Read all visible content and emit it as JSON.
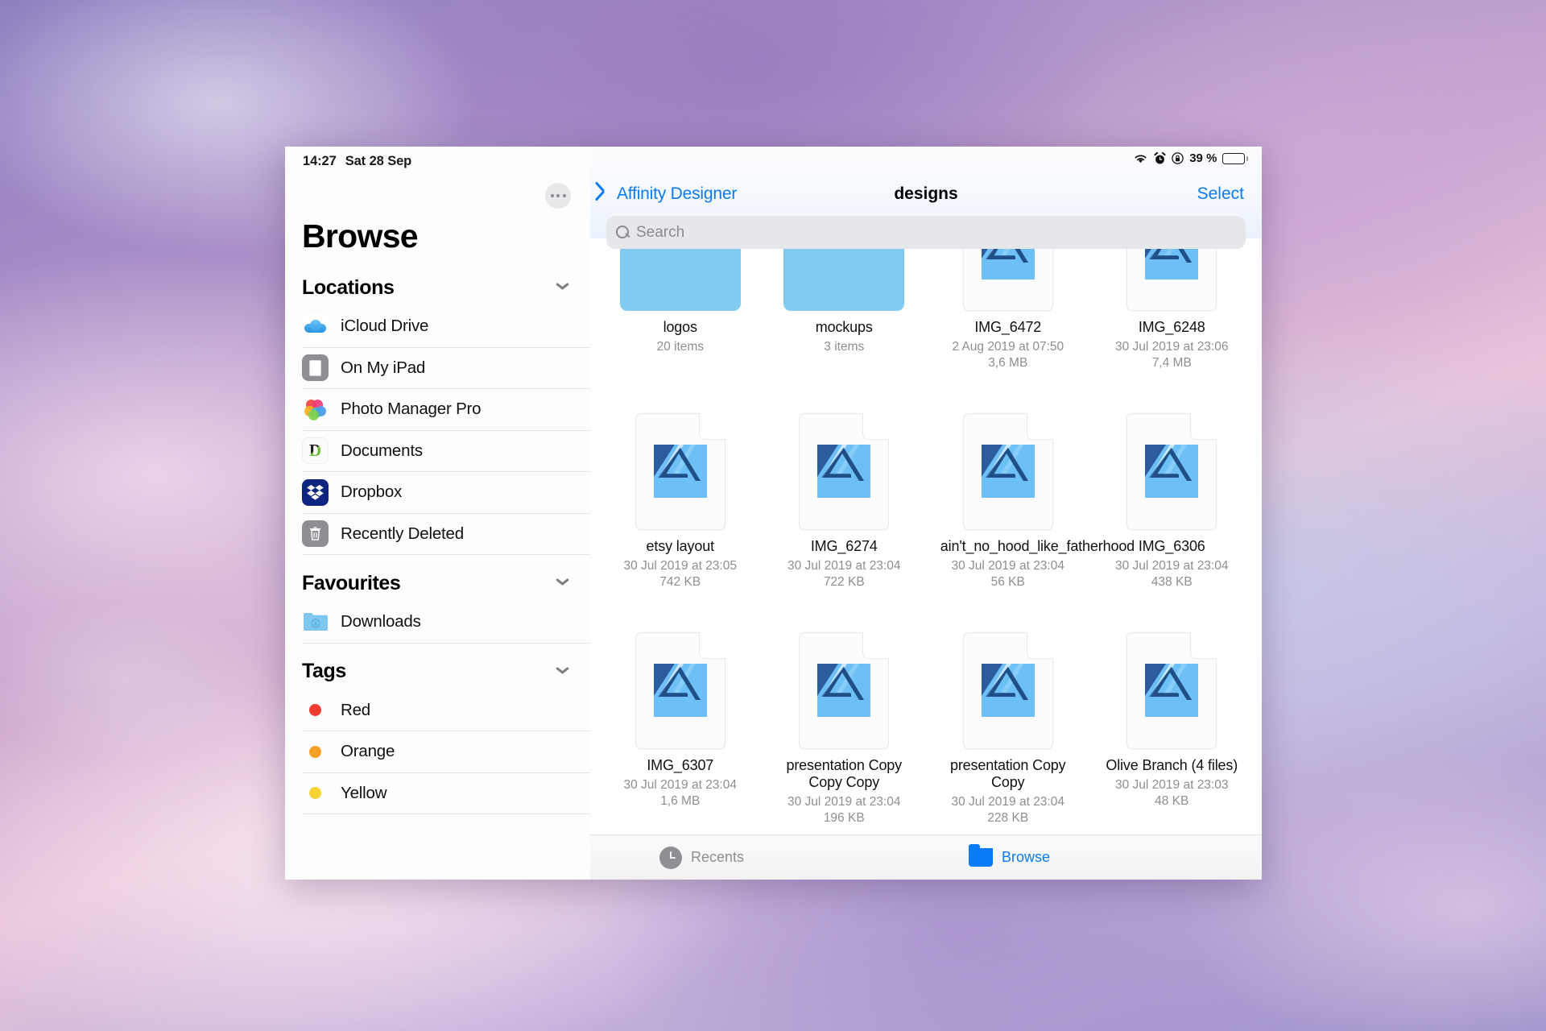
{
  "wallpaper": {
    "description": "pastel purple pink cloud sky"
  },
  "statusbar": {
    "time": "14:27",
    "date": "Sat 28 Sep",
    "wifi_icon": "wifi-icon",
    "alarm_icon": "alarm-clock-icon",
    "rotation_lock_icon": "rotation-lock-icon",
    "battery_percent": "39 %",
    "battery_icon": "battery-icon",
    "battery_level": 39
  },
  "sidebar": {
    "more_button": "more-options-icon",
    "title": "Browse",
    "sections": [
      {
        "name": "Locations",
        "collapse_icon": "chevron-down-icon",
        "items": [
          {
            "label": "iCloud Drive",
            "icon": "icloud-drive-icon"
          },
          {
            "label": "On My iPad",
            "icon": "ipad-icon"
          },
          {
            "label": "Photo Manager Pro",
            "icon": "photo-manager-pro-icon"
          },
          {
            "label": "Documents",
            "icon": "documents-app-icon"
          },
          {
            "label": "Dropbox",
            "icon": "dropbox-icon"
          },
          {
            "label": "Recently Deleted",
            "icon": "trash-icon"
          }
        ]
      },
      {
        "name": "Favourites",
        "collapse_icon": "chevron-down-icon",
        "items": [
          {
            "label": "Downloads",
            "icon": "downloads-folder-icon"
          }
        ]
      },
      {
        "name": "Tags",
        "collapse_icon": "chevron-down-icon",
        "items": [
          {
            "label": "Red",
            "icon": "tag-dot-icon",
            "color": "#f03b33"
          },
          {
            "label": "Orange",
            "icon": "tag-dot-icon",
            "color": "#f3a227"
          },
          {
            "label": "Yellow",
            "icon": "tag-dot-icon",
            "color": "#f7d336"
          }
        ]
      }
    ]
  },
  "navbar": {
    "back_label": "Affinity Designer",
    "back_icon": "chevron-left-icon",
    "title": "designs",
    "select_label": "Select"
  },
  "search": {
    "placeholder": "Search",
    "value": "",
    "icon": "search-icon"
  },
  "files": [
    {
      "name": "logos",
      "kind": "folder",
      "meta1": "20 items",
      "meta2": ""
    },
    {
      "name": "mockups",
      "kind": "folder",
      "meta1": "3 items",
      "meta2": ""
    },
    {
      "name": "IMG_6472",
      "kind": "file",
      "meta1": "2 Aug 2019 at 07:50",
      "meta2": "3,6 MB"
    },
    {
      "name": "IMG_6248",
      "kind": "file",
      "meta1": "30 Jul 2019 at 23:06",
      "meta2": "7,4 MB"
    },
    {
      "name": "etsy layout",
      "kind": "file",
      "meta1": "30 Jul 2019 at 23:05",
      "meta2": "742 KB"
    },
    {
      "name": "IMG_6274",
      "kind": "file",
      "meta1": "30 Jul 2019 at 23:04",
      "meta2": "722 KB"
    },
    {
      "name": "ain't_no_hood_like_fatherhood",
      "kind": "file",
      "meta1": "30 Jul 2019 at 23:04",
      "meta2": "56 KB"
    },
    {
      "name": "IMG_6306",
      "kind": "file",
      "meta1": "30 Jul 2019 at 23:04",
      "meta2": "438 KB"
    },
    {
      "name": "IMG_6307",
      "kind": "file",
      "meta1": "30 Jul 2019 at 23:04",
      "meta2": "1,6 MB"
    },
    {
      "name": "presentation Copy Copy Copy",
      "kind": "file",
      "meta1": "30 Jul 2019 at 23:04",
      "meta2": "196 KB"
    },
    {
      "name": "presentation Copy Copy",
      "kind": "file",
      "meta1": "30 Jul 2019 at 23:04",
      "meta2": "228 KB"
    },
    {
      "name": "Olive Branch (4 files)",
      "kind": "file",
      "meta1": "30 Jul 2019 at 23:03",
      "meta2": "48 KB"
    }
  ],
  "tabbar": {
    "recents_label": "Recents",
    "recents_icon": "clock-icon",
    "browse_label": "Browse",
    "browse_icon": "folder-icon"
  },
  "colors": {
    "accent": "#0a7bf7",
    "folder": "#82cbf0",
    "meta_text": "#8e8e93",
    "afd_dark": "#2b5d9e",
    "afd_light": "#6cc0f5"
  }
}
